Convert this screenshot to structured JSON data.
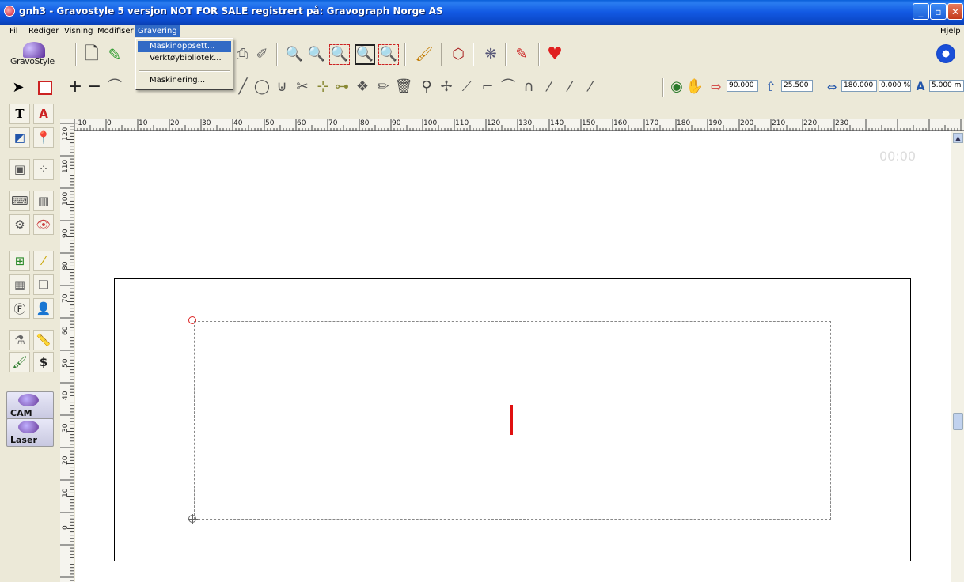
{
  "window": {
    "title": "gnh3 - Gravostyle 5  versjon NOT FOR SALE registrert på: Gravograph Norge AS",
    "buttons": {
      "minimize": "_",
      "maximize": "▫",
      "close": "✕"
    }
  },
  "menubar": {
    "items": [
      "Fil",
      "Rediger",
      "Visning",
      "Modifiser",
      "Gravering"
    ],
    "active_index": 4,
    "help": "Hjelp"
  },
  "gravering_menu": {
    "items": [
      "Maskinoppsett...",
      "Verktøybibliotek...",
      "Maskinering..."
    ],
    "highlighted_index": 0
  },
  "logo": {
    "text": "GravoStyle"
  },
  "toolbar2": {
    "fields": {
      "f1": "90.000",
      "f2": "25.500",
      "f3": "180.000",
      "f4": "0.000 %",
      "f5": "5.000 m"
    }
  },
  "ruler": {
    "h_labels": [
      "-10",
      "0",
      "10",
      "20",
      "30",
      "40",
      "50",
      "60",
      "70",
      "80",
      "90",
      "100",
      "110",
      "120",
      "130",
      "140",
      "150",
      "160",
      "170",
      "180",
      "190",
      "200",
      "210",
      "220",
      "230"
    ],
    "v_labels": [
      "120",
      "110",
      "100",
      "90",
      "80",
      "70",
      "60",
      "50",
      "40",
      "30",
      "20",
      "10",
      "0"
    ]
  },
  "left_panel": {
    "tabs": [
      "CAM",
      "Laser"
    ]
  },
  "canvas": {
    "faint_value": "00:00"
  },
  "colors": {
    "titlebar": "#1259e3",
    "menu_highlight": "#316ac5",
    "cursor_mark": "#e01010",
    "chrome": "#ece9d8"
  }
}
